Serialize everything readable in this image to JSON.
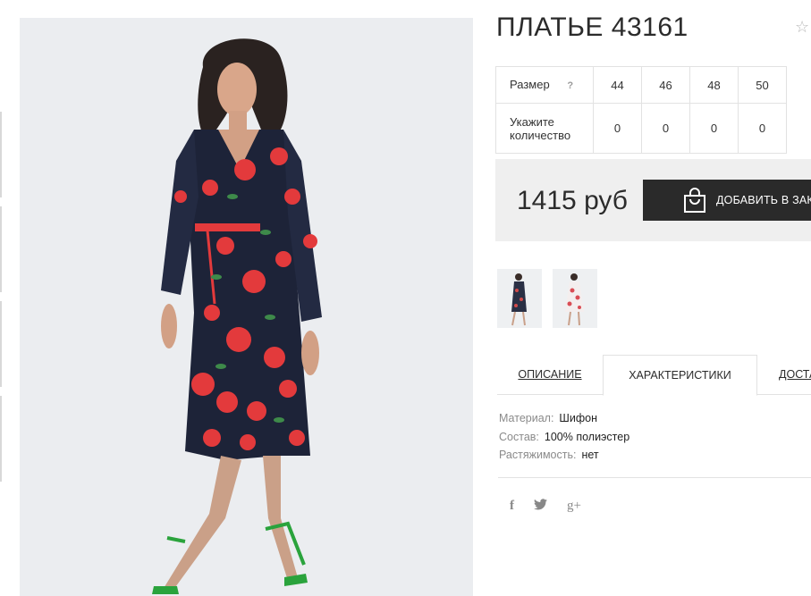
{
  "product": {
    "title": "ПЛАТЬЕ 43161",
    "favorite_icon": "star-outline-icon"
  },
  "size_table": {
    "size_label": "Размер",
    "help_label": "?",
    "sizes": [
      "44",
      "46",
      "48",
      "50"
    ],
    "qty_label": "Укажите количество",
    "quantities": [
      "0",
      "0",
      "0",
      "0"
    ]
  },
  "purchase": {
    "price": "1415 руб",
    "add_button_label": "ДОБАВИТЬ В ЗАКАЗ",
    "bag_icon": "shopping-bag-icon"
  },
  "tabs": {
    "description": "ОПИСАНИЕ",
    "characteristics": "ХАРАКТЕРИСТИКИ",
    "delivery": "ДОСТАВКА"
  },
  "specs": [
    {
      "key": "Материал:",
      "value": "Шифон"
    },
    {
      "key": "Состав:",
      "value": "100% полиэстер"
    },
    {
      "key": "Растяжимость:",
      "value": "нет"
    }
  ],
  "social": {
    "facebook": "f",
    "twitter": "🐦",
    "google_plus": "g+"
  },
  "colors": {
    "button_bg": "#2a2a2a",
    "price_box_bg": "#efefef",
    "border": "#e2e2e2",
    "dress_navy": "#1d2338",
    "rose_red": "#e33a3c",
    "shoe_green": "#2aa33c"
  }
}
